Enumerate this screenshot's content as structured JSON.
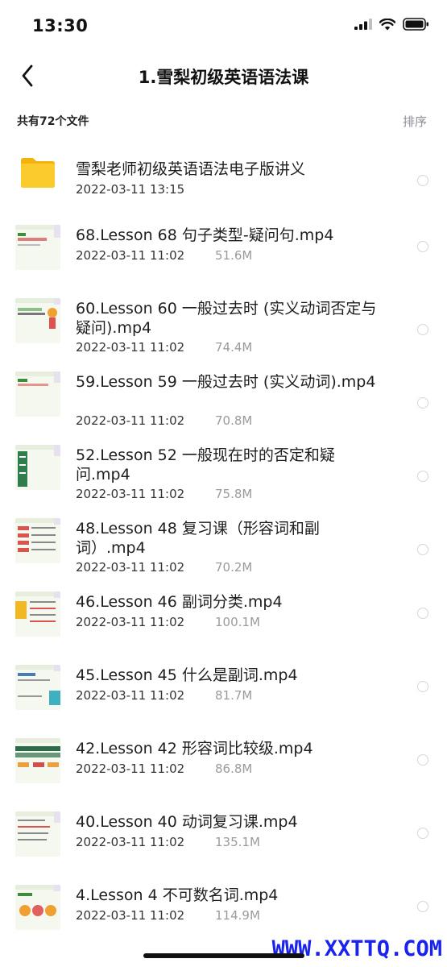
{
  "status_bar": {
    "time": "13:30"
  },
  "nav": {
    "title": "1.雪梨初级英语语法课"
  },
  "summary": {
    "count_text": "共有72个文件",
    "sort_label": "排序"
  },
  "files": [
    {
      "name": "雪梨老师初级英语语法电子版讲义",
      "date": "2022-03-11 13:15",
      "size": "",
      "type": "folder"
    },
    {
      "name": "68.Lesson 68 句子类型-疑问句.mp4",
      "date": "2022-03-11 11:02",
      "size": "51.6M",
      "type": "video"
    },
    {
      "name": "60.Lesson 60 一般过去时 (实义动词否定与疑问).mp4",
      "date": "2022-03-11 11:02",
      "size": "74.4M",
      "type": "video"
    },
    {
      "name": "59.Lesson 59 一般过去时 (实义动词).mp4",
      "date": "2022-03-11 11:02",
      "size": "70.8M",
      "type": "video"
    },
    {
      "name": "52.Lesson 52 一般现在时的否定和疑问.mp4",
      "date": "2022-03-11 11:02",
      "size": "75.8M",
      "type": "video"
    },
    {
      "name": "48.Lesson 48 复习课（形容词和副词）.mp4",
      "date": "2022-03-11 11:02",
      "size": "70.2M",
      "type": "video"
    },
    {
      "name": "46.Lesson 46 副词分类.mp4",
      "date": "2022-03-11 11:02",
      "size": "100.1M",
      "type": "video"
    },
    {
      "name": "45.Lesson 45 什么是副词.mp4",
      "date": "2022-03-11 11:02",
      "size": "81.7M",
      "type": "video"
    },
    {
      "name": "42.Lesson 42 形容词比较级.mp4",
      "date": "2022-03-11 11:02",
      "size": "86.8M",
      "type": "video"
    },
    {
      "name": "40.Lesson 40 动词复习课.mp4",
      "date": "2022-03-11 11:02",
      "size": "135.1M",
      "type": "video"
    },
    {
      "name": "4.Lesson 4 不可数名词.mp4",
      "date": "2022-03-11 11:02",
      "size": "114.9M",
      "type": "video"
    }
  ],
  "watermark": "WWW.XXTTQ.COM",
  "colors": {
    "folder": "#f8c21c",
    "accent_green": "#4caf50",
    "watermark": "#1a22ee",
    "meta_gray": "#9a9aa0"
  }
}
